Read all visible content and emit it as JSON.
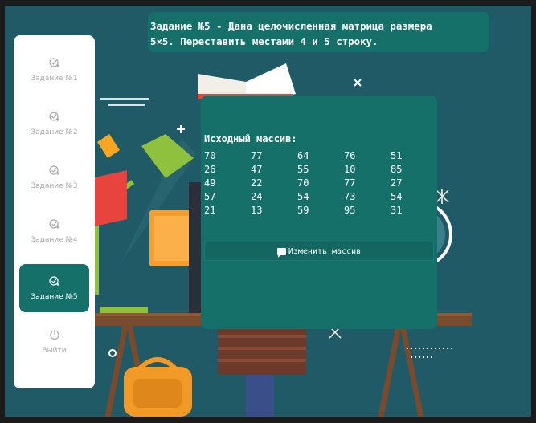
{
  "header": {
    "task_text_line1": "Задание №5 - Дана целочисленная матрица размера",
    "task_text_line2": "5×5. Переставить местами 4 и 5 строку."
  },
  "sidebar": {
    "items": [
      {
        "label": "Задание №1",
        "icon": "check-add-icon"
      },
      {
        "label": "Задание №2",
        "icon": "check-add-icon"
      },
      {
        "label": "Задание №3",
        "icon": "check-add-icon"
      },
      {
        "label": "Задание №4",
        "icon": "check-add-icon"
      },
      {
        "label": "Задание №5",
        "icon": "check-add-icon",
        "active": true
      },
      {
        "label": "Выйти",
        "icon": "power-icon"
      }
    ]
  },
  "panel": {
    "array_title": "Исходный массив:",
    "matrix": [
      [
        "70",
        "77",
        "64",
        "76",
        "51"
      ],
      [
        "26",
        "47",
        "55",
        "10",
        "85"
      ],
      [
        "49",
        "22",
        "70",
        "77",
        "27"
      ],
      [
        "57",
        "24",
        "54",
        "73",
        "54"
      ],
      [
        "21",
        "13",
        "59",
        "95",
        "31"
      ]
    ],
    "button_label": "Изменить массив",
    "button_icon": "message-icon"
  },
  "colors": {
    "background": "#1f5a66",
    "accent": "#157069",
    "sidebar_bg": "#ffffff",
    "inactive_text": "#a9a9a9"
  }
}
